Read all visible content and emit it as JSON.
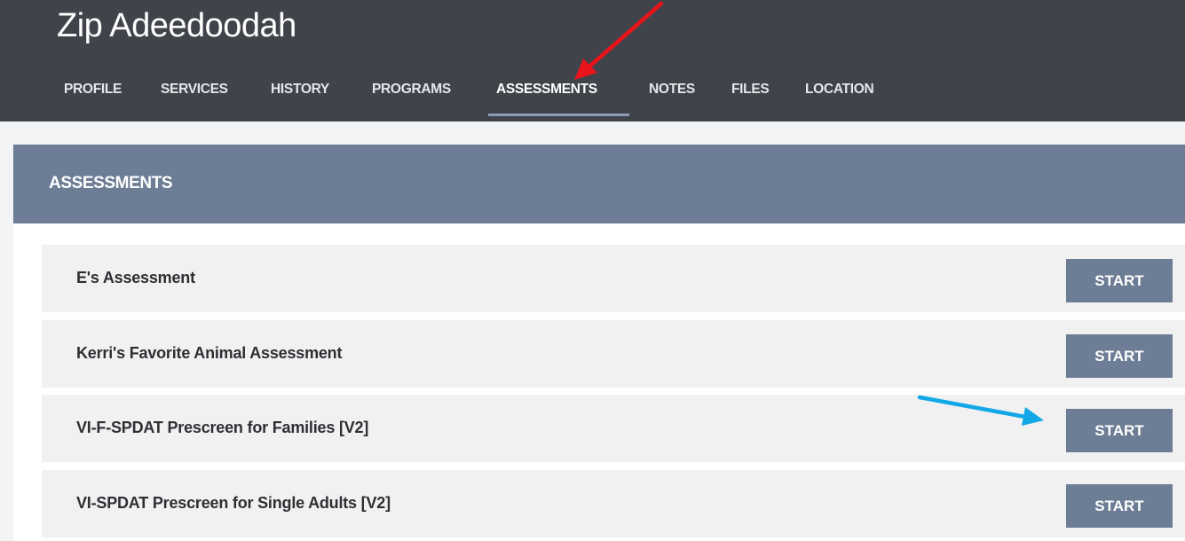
{
  "client": {
    "name": "Zip Adeedoodah"
  },
  "tabs": [
    {
      "label": "PROFILE",
      "active": false
    },
    {
      "label": "SERVICES",
      "active": false
    },
    {
      "label": "HISTORY",
      "active": false
    },
    {
      "label": "PROGRAMS",
      "active": false
    },
    {
      "label": "ASSESSMENTS",
      "active": true
    },
    {
      "label": "NOTES",
      "active": false
    },
    {
      "label": "FILES",
      "active": false
    },
    {
      "label": "LOCATION",
      "active": false
    }
  ],
  "panel": {
    "title": "ASSESSMENTS"
  },
  "assessments": [
    {
      "name": "E's Assessment",
      "action": "START"
    },
    {
      "name": "Kerri's Favorite Animal Assessment",
      "action": "START"
    },
    {
      "name": "VI-F-SPDAT Prescreen for Families [V2]",
      "action": "START"
    },
    {
      "name": "VI-SPDAT Prescreen for Single Adults [V2]",
      "action": "START"
    }
  ],
  "annotations": [
    {
      "name": "red-arrow",
      "color": "#e8141a",
      "points_to": "ASSESSMENTS tab"
    },
    {
      "name": "blue-arrow",
      "color": "#12a7e6",
      "points_to": "START button for VI-F-SPDAT Prescreen for Families [V2]"
    }
  ],
  "colors": {
    "header_bg": "#41434b",
    "accent": "#6c7d95",
    "row_bg": "#f1f1f2"
  }
}
